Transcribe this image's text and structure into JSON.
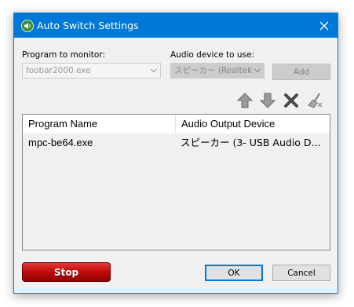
{
  "window": {
    "title": "Auto Switch Settings"
  },
  "program_field": {
    "label": "Program to monitor:",
    "value": "foobar2000.exe"
  },
  "device_field": {
    "label": "Audio device to use:",
    "value": "スピーカー (Realtek H"
  },
  "buttons": {
    "add": "Add",
    "stop": "Stop",
    "ok": "OK",
    "cancel": "Cancel"
  },
  "toolbar_icons": [
    "arrow-up-icon",
    "arrow-down-icon",
    "delete-x-icon",
    "clear-broom-icon"
  ],
  "list": {
    "columns": [
      "Program Name",
      "Audio Output Device"
    ],
    "rows": [
      {
        "program": "mpc-be64.exe",
        "device": "スピーカー (3- USB Audio D..."
      }
    ]
  },
  "colors": {
    "titlebar": "#0078d7",
    "stop_button": "#c40d0d"
  }
}
